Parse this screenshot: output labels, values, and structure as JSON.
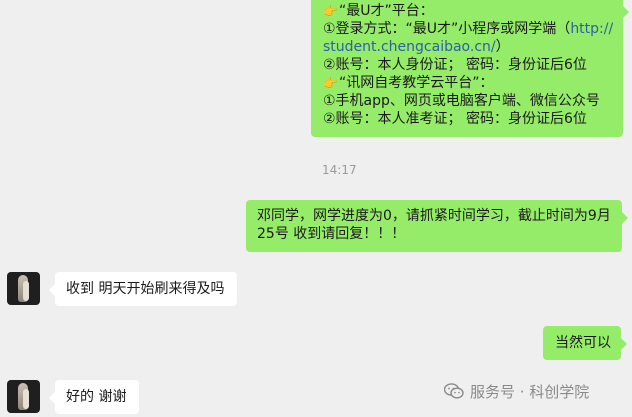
{
  "messages": {
    "top_notice": {
      "line1_prefix": "“最U才”平台：",
      "line2": "①登录方式：“最U才”小程序或网学端（",
      "line2_link": "http://",
      "line3_link": "student.chengcaibao.cn/",
      "line3_suffix": "）",
      "line4": "②账号：本人身份证；  密码：身份证后6位",
      "line5_prefix": "“讯网自考教学云平台”：",
      "line6": "①手机app、网页或电脑客户端、微信公众号",
      "line7": "②账号：本人准考证；  密码：身份证后6位",
      "hand_icon": "pointing-hand-icon"
    },
    "timestamp": "14:17",
    "teacher_msg": {
      "line1": "邓同学，网学进度为0，请抓紧时间学习，截止时间为9月",
      "line2": "25号  收到请回复！！！"
    },
    "student_msg1": "收到 明天开始刷来得及吗",
    "teacher_reply": "当然可以",
    "student_msg2": "好的 谢谢"
  },
  "watermark": {
    "icon": "wechat-icon",
    "text": "服务号 · 科创学院"
  },
  "colors": {
    "outgoing_bubble": "#95ec69",
    "incoming_bubble": "#ffffff",
    "background": "#efefef",
    "link": "#2a61a8"
  }
}
